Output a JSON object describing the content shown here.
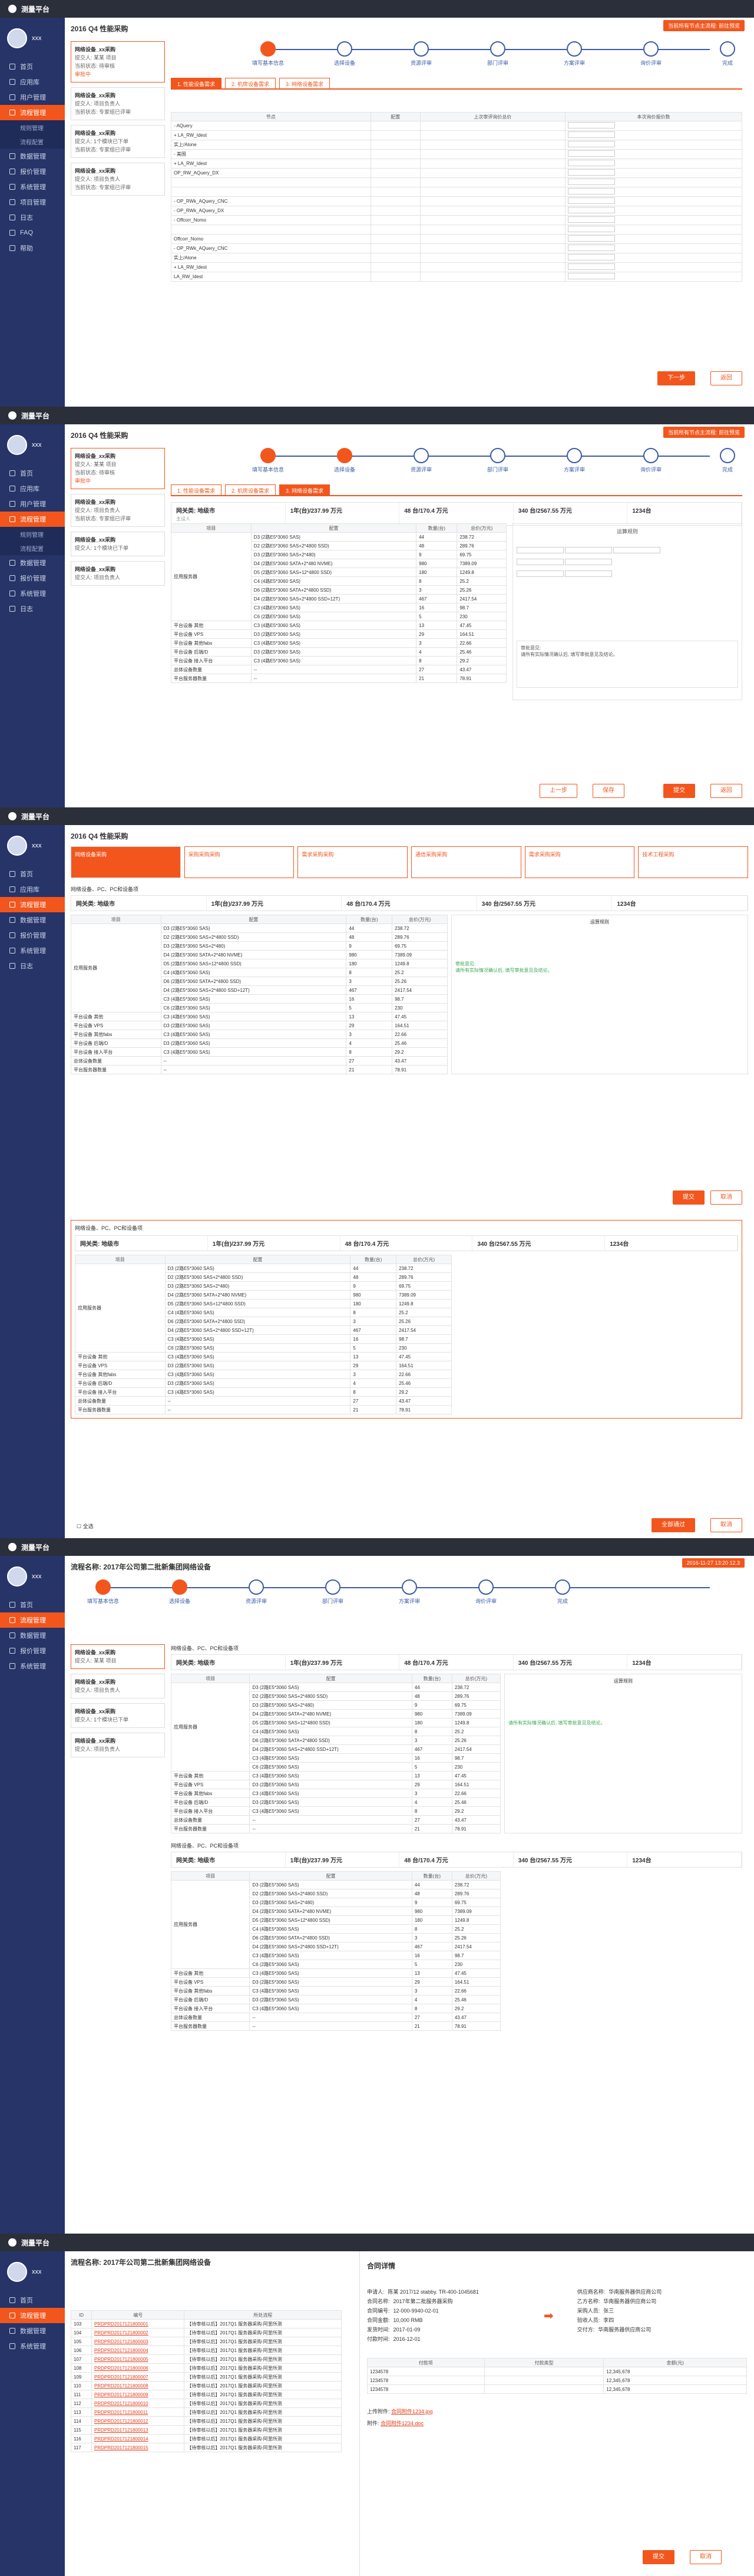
{
  "app": {
    "title": "测量平台",
    "user": "xxx"
  },
  "nav": [
    {
      "label": "首页"
    },
    {
      "label": "应用库"
    },
    {
      "label": "用户管理"
    },
    {
      "label": "流程管理"
    },
    {
      "label": "数据管理"
    },
    {
      "label": "报价管理"
    },
    {
      "label": "系统管理"
    },
    {
      "label": "项目管理"
    },
    {
      "label": "日志"
    },
    {
      "label": "FAQ"
    },
    {
      "label": "帮助"
    }
  ],
  "nav_sub": [
    "规则管理",
    "流程配置"
  ],
  "page": {
    "title": "2016 Q4 性能采购",
    "warning": "当前所有节点主流程: 前往预览"
  },
  "steps": [
    "填写基本信息",
    "选择设备",
    "资源评审",
    "部门评审",
    "方案评审",
    "询价评审",
    "完成"
  ],
  "left_cards": [
    {
      "title": "网络设备_xx采购",
      "l1": "提交人: 某某 项目",
      "l2": "当前状态: 待审核",
      "red": "审批中"
    },
    {
      "title": "网络设备_xx采购",
      "l1": "提交人: 项目负责人",
      "l2": "当前状态: 专家组已评审",
      "red": ""
    },
    {
      "title": "网络设备_xx采购",
      "l1": "提交人: 1个模块已下单",
      "l2": "当前状态: 专家组已评审",
      "red": ""
    },
    {
      "title": "网络设备_xx采购",
      "l1": "提交人: 项目负责人",
      "l2": "当前状态: 专家组已评审",
      "red": ""
    }
  ],
  "tabs": [
    "1. 性能设备需求",
    "2. 机房设备需求",
    "3. 网络设备需求"
  ],
  "tree_headers": [
    "节点",
    "配置",
    "",
    "上次审评询价总价",
    "本次询价报价数"
  ],
  "tree_rows": [
    {
      "node": "- AQuery",
      "tag1": "",
      "tag2": "",
      "v1": "",
      "v2": ""
    },
    {
      "node": "+ LA_RW_Idest",
      "tag1": "",
      "tag2": "",
      "v1": "",
      "v2": ""
    },
    {
      "node": "实上/Alone",
      "tag1": "",
      "tag2": "",
      "v1": "",
      "v2": ""
    },
    {
      "node": "- 美国",
      "tag1": "",
      "tag2": "",
      "v1": "",
      "v2": ""
    },
    {
      "node": "+ LA_RW_Idest",
      "tag1": "",
      "tag2": "",
      "v1": "",
      "v2": ""
    },
    {
      "node": "OP_RW_AQuery_DX",
      "tag1": "",
      "tag2": "",
      "v1": "",
      "v2": ""
    },
    {
      "node": "",
      "tag1": "",
      "tag2": "",
      "v1": "",
      "v2": ""
    },
    {
      "node": "",
      "tag1": "",
      "tag2": "",
      "v1": "",
      "v2": ""
    },
    {
      "node": "- OP_RWk_AQuery_CNC",
      "tag1": "",
      "tag2": "",
      "v1": "",
      "v2": ""
    },
    {
      "node": "- OP_RWk_AQuery_DX",
      "tag1": "",
      "tag2": "",
      "v1": "",
      "v2": ""
    },
    {
      "node": "- Offcorr_Nomo",
      "tag1": "",
      "tag2": "",
      "v1": "",
      "v2": ""
    },
    {
      "node": "",
      "tag1": "",
      "tag2": "",
      "v1": "",
      "v2": ""
    },
    {
      "node": "Offcorr_Nomo",
      "tag1": "",
      "tag2": "",
      "v1": "",
      "v2": ""
    },
    {
      "node": "- OP_RWk_AQuery_CNC",
      "tag1": "",
      "tag2": "",
      "v1": "",
      "v2": ""
    },
    {
      "node": "实上/Alone",
      "tag1": "",
      "tag2": "",
      "v1": "",
      "v2": ""
    },
    {
      "node": "+ LA_RW_Idest",
      "tag1": "",
      "tag2": "",
      "v1": "",
      "v2": ""
    },
    {
      "node": "LA_RW_Idest",
      "tag1": "",
      "tag2": "",
      "v1": "",
      "v2": ""
    }
  ],
  "buttons": {
    "next": "下一步",
    "back": "返回",
    "prev": "上一步",
    "save": "保存",
    "submit": "提交",
    "confirm": "确定",
    "cancel": "取消"
  },
  "summary": [
    {
      "label": "网关类: 地级市",
      "sub": "主设人"
    },
    {
      "label": "1年(台)/237.99 万元",
      "sub": ""
    },
    {
      "label": "48 台/170.4 万元",
      "sub": ""
    },
    {
      "label": "340 台/2567.55 万元",
      "sub": ""
    },
    {
      "label": "1234台",
      "sub": ""
    }
  ],
  "spec_headers": [
    "项目",
    "配置",
    "数量(台)",
    "总价(万元)",
    "运算规则"
  ],
  "spec_group": "应用服务器",
  "spec_rows": [
    {
      "cfg": "D3 (2路E5*3060 SAS)",
      "qty": "44",
      "price": "238.72"
    },
    {
      "cfg": "D2 (2路E5*3060 SAS+2*4800 SSD)",
      "qty": "48",
      "price": "289.76"
    },
    {
      "cfg": "D3 (2路E5*3060 SAS+2*480)",
      "qty": "9",
      "price": "69.75"
    },
    {
      "cfg": "D4 (2路E5*3060 SATA+2*480 NVME)",
      "qty": "980",
      "price": "7389.09"
    },
    {
      "cfg": "D5 (2路E5*3060 SAS+12*4800 SSD)",
      "qty": "180",
      "price": "1249.8"
    },
    {
      "cfg": "C4 (4路E5*3060 SAS)",
      "qty": "8",
      "price": "25.2"
    },
    {
      "cfg": "D6 (2路E5*3060 SATA+2*4800 SSD)",
      "qty": "3",
      "price": "25.26"
    },
    {
      "cfg": "D4 (2路E5*3060 SAS+2*4800 SSD+12T)",
      "qty": "467",
      "price": "2417.54"
    },
    {
      "cfg": "C3 (4路E5*3060 SAS)",
      "qty": "16",
      "price": "98.7"
    },
    {
      "cfg": "C6 (2路E5*3060 SAS)",
      "qty": "5",
      "price": "230"
    }
  ],
  "spec_extra": [
    {
      "name": "平台设备 其他",
      "cfg": "C3 (4路E5*3060 SAS)",
      "qty": "13",
      "price": "47.45"
    },
    {
      "name": "平台设备 VPS",
      "cfg": "D3 (2路E5*3060 SAS)",
      "qty": "29",
      "price": "164.51"
    },
    {
      "name": "平台设备 其他fabs",
      "cfg": "C3 (4路E5*3060 SAS)",
      "qty": "3",
      "price": "22.66"
    },
    {
      "name": "平台设备 后端/D",
      "cfg": "D3 (2路E5*3060 SAS)",
      "qty": "4",
      "price": "25.46"
    },
    {
      "name": "平台设备 接入平台",
      "cfg": "C3 (4路E5*3060 SAS)",
      "qty": "8",
      "price": "29.2"
    },
    {
      "name": "总体设备数量",
      "cfg": "--",
      "qty": "27",
      "price": "43.47"
    },
    {
      "name": "平台服务器数量",
      "cfg": "--",
      "qty": "21",
      "price": "78.91"
    }
  ],
  "rules": {
    "title": "运算规则",
    "note_title": "审批意见:",
    "note": "请所有实际情况确认后, 填写审批意见及结论。"
  },
  "screen3": {
    "heads": [
      "网络设备采购",
      "采购采购采购",
      "需求采购采购",
      "通信采购采购",
      "需求采购采购",
      "技术工程采购"
    ],
    "section": "网络设备、PC、PC和设备项",
    "checkbox": "全选",
    "apply": "全部通过"
  },
  "screen4": {
    "title": "流程名称: 2017年公司第二批新集团网络设备",
    "date": "2016-11-27 13:20 12.3"
  },
  "screen5": {
    "title": "流程名称: 2017年公司第二批新集团网络设备",
    "list_headers": [
      "ID",
      "编号",
      "所处流程"
    ],
    "list": [
      {
        "id": "103",
        "code": "PRDPRD2017121800001",
        "flow": "【待审核以后】2017Q1 服务器采购-阿里所测"
      },
      {
        "id": "104",
        "code": "PRDPRD2017121800002",
        "flow": "【待审核以后】2017Q1 服务器采购-阿里所测"
      },
      {
        "id": "105",
        "code": "PRDPRD2017121800003",
        "flow": "【待审核以后】2017Q1 服务器采购-阿里所测"
      },
      {
        "id": "106",
        "code": "PRDPRD2017121800004",
        "flow": "【待审核以后】2017Q1 服务器采购-阿里所测"
      },
      {
        "id": "107",
        "code": "PRDPRD2017121800005",
        "flow": "【待审核以后】2017Q1 服务器采购-阿里所测"
      },
      {
        "id": "108",
        "code": "PRDPRD2017121800006",
        "flow": "【待审核以后】2017Q1 服务器采购-阿里所测"
      },
      {
        "id": "109",
        "code": "PRDPRD2017121800007",
        "flow": "【待审核以后】2017Q1 服务器采购-阿里所测"
      },
      {
        "id": "110",
        "code": "PRDPRD2017121800008",
        "flow": "【待审核以后】2017Q1 服务器采购-阿里所测"
      },
      {
        "id": "111",
        "code": "PRDPRD2017121800009",
        "flow": "【待审核以后】2017Q1 服务器采购-阿里所测"
      },
      {
        "id": "112",
        "code": "PRDPRD2017121800010",
        "flow": "【待审核以后】2017Q1 服务器采购-阿里所测"
      },
      {
        "id": "113",
        "code": "PRDPRD2017121800011",
        "flow": "【待审核以后】2017Q1 服务器采购-阿里所测"
      },
      {
        "id": "114",
        "code": "PRDPRD2017121800012",
        "flow": "【待审核以后】2017Q1 服务器采购-阿里所测"
      },
      {
        "id": "115",
        "code": "PRDPRD2017121800013",
        "flow": "【待审核以后】2017Q1 服务器采购-阿里所测"
      },
      {
        "id": "116",
        "code": "PRDPRD2017121800014",
        "flow": "【待审核以后】2017Q1 服务器采购-阿里所测"
      },
      {
        "id": "117",
        "code": "PRDPRD2017121800015",
        "flow": "【待审核以后】2017Q1 服务器采购-阿里所测"
      }
    ],
    "detail_title": "合同详情",
    "detail_rows": [
      {
        "k": "申请人:",
        "v": "陈某 2017/12 stabby. TR-400-1045681"
      },
      {
        "k": "合同名称:",
        "v": "2017年第二批服务器采购"
      },
      {
        "k": "合同编号:",
        "v": "12-000-9940-02-01"
      },
      {
        "k": "合同金额:",
        "v": "10,000 RMB"
      },
      {
        "k": "发货时间:",
        "v": "2017-01-09"
      },
      {
        "k": "付款时间:",
        "v": "2016-12-01"
      }
    ],
    "detail_right": [
      {
        "k": "供应商名称:",
        "v": "华南服务器供应商公司"
      },
      {
        "k": "乙方名称:",
        "v": "华南服务器供应商公司"
      },
      {
        "k": "采购人员:",
        "v": "张三"
      },
      {
        "k": "验收人员:",
        "v": "李四"
      },
      {
        "k": "交付方:",
        "v": "华南服务器供应商公司"
      }
    ],
    "pay_headers": [
      "付款项",
      "付款类型",
      "金额(元)"
    ],
    "pay_rows": [
      {
        "a": "1234578",
        "b": "",
        "c": "12,345,678"
      },
      {
        "a": "1234578",
        "b": "",
        "c": "12,345,678"
      },
      {
        "a": "1234578",
        "b": "",
        "c": "12,345,678"
      }
    ],
    "upload1": "上传附件",
    "upload2": "附件",
    "file1": "合同附件1234.jpg",
    "file2": "合同附件1234.doc"
  }
}
